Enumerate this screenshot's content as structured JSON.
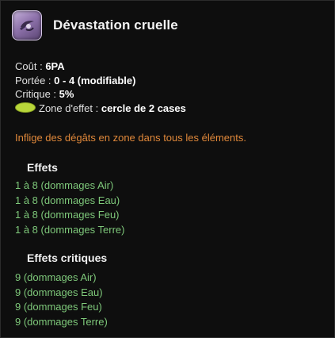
{
  "spell": {
    "title": "Dévastation cruelle",
    "icon": "sword-slash-icon"
  },
  "stats": {
    "cost_label": "Coût :",
    "cost_value": "6PA",
    "range_label": "Portée :",
    "range_value": "0 - 4 (modifiable)",
    "critical_label": "Critique :",
    "critical_value": "5%",
    "zone_label": "Zone d'effet :",
    "zone_value": "cercle de 2 cases"
  },
  "description": "Inflige des dégâts en zone dans tous les éléments.",
  "effects": {
    "title": "Effets",
    "items": [
      "1 à 8 (dommages Air)",
      "1 à 8 (dommages Eau)",
      "1 à 8 (dommages Feu)",
      "1 à 8 (dommages Terre)"
    ]
  },
  "critical_effects": {
    "title": "Effets critiques",
    "items": [
      "9 (dommages Air)",
      "9 (dommages Eau)",
      "9 (dommages Feu)",
      "9 (dommages Terre)"
    ]
  },
  "colors": {
    "description": "#e0883a",
    "effect": "#7ec87a",
    "zone_marker": "#b8d63a"
  }
}
